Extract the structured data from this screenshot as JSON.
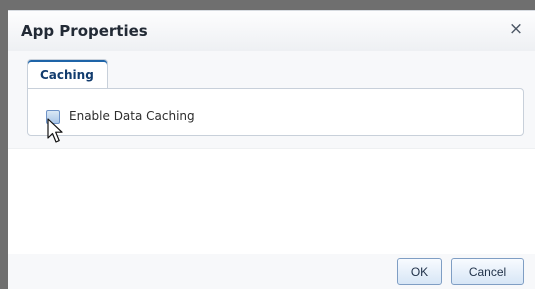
{
  "dialog": {
    "title": "App Properties",
    "close_icon": "close-icon"
  },
  "tabs": [
    {
      "label": "Caching",
      "selected": true
    }
  ],
  "caching": {
    "enable_data_caching": {
      "label": "Enable Data Caching",
      "checked": false
    }
  },
  "buttons": {
    "ok": "OK",
    "cancel": "Cancel"
  },
  "icons": {
    "close": "close-icon",
    "cursor": "mouse-pointer-icon"
  },
  "colors": {
    "accent": "#1e64a8",
    "tab_label": "#123c6e",
    "button_border": "#7f9ec4"
  }
}
